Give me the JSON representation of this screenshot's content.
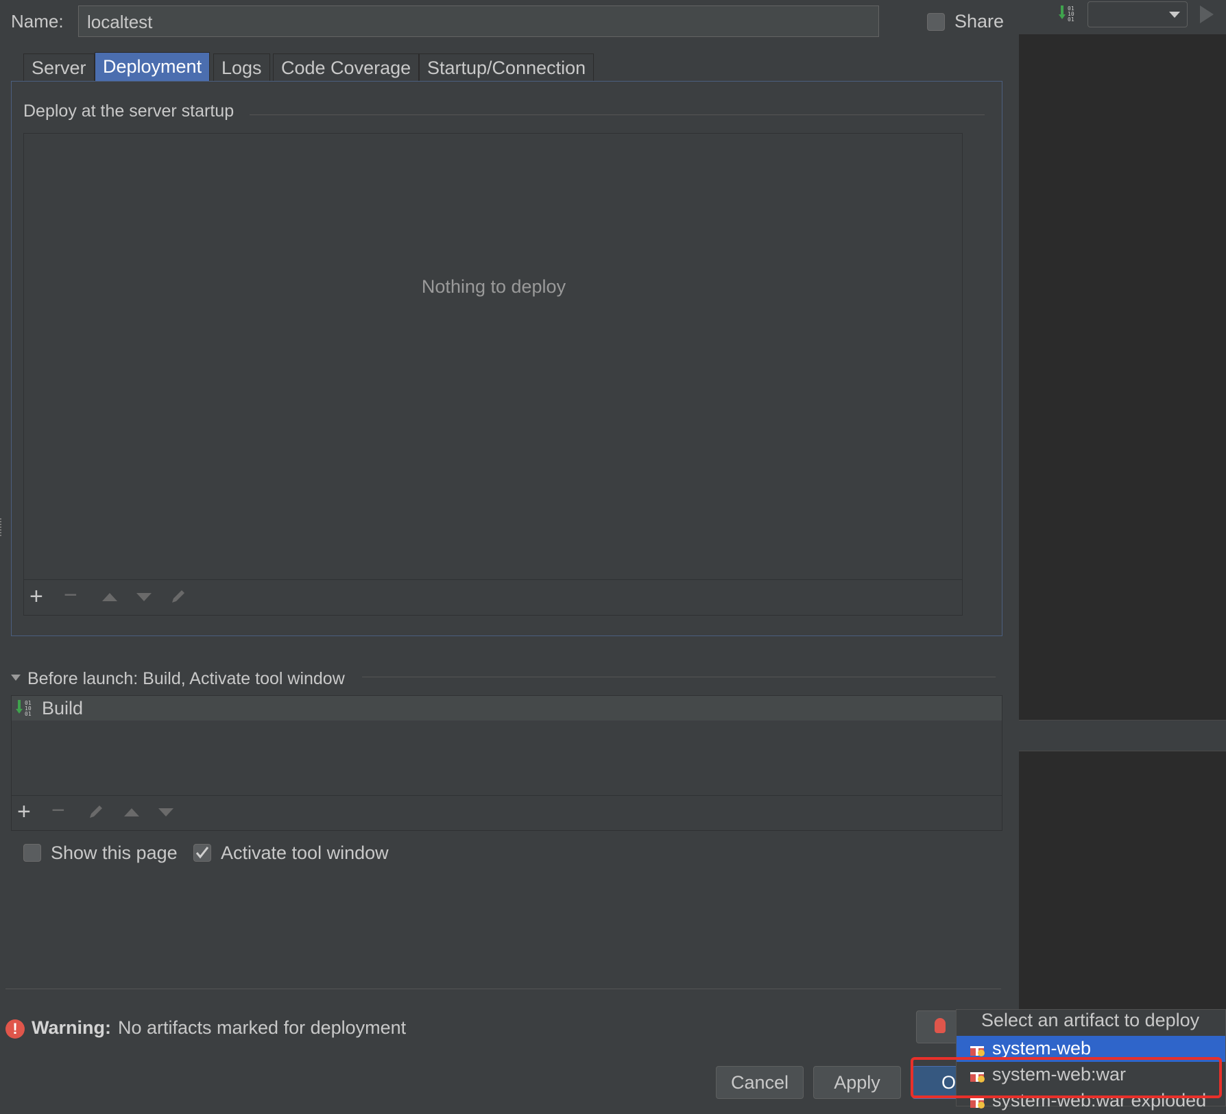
{
  "header": {
    "name_label": "Name:",
    "name_value": "localtest",
    "share_label": "Share"
  },
  "tabs": [
    {
      "label": "Server",
      "selected": false
    },
    {
      "label": "Deployment",
      "selected": true
    },
    {
      "label": "Logs",
      "selected": false
    },
    {
      "label": "Code Coverage",
      "selected": false
    },
    {
      "label": "Startup/Connection",
      "selected": false
    }
  ],
  "deployment": {
    "section_title": "Deploy at the server startup",
    "empty_text": "Nothing to deploy"
  },
  "before_launch": {
    "title": "Before launch: Build, Activate tool window",
    "items": [
      {
        "label": "Build",
        "icon": "build-icon"
      }
    ]
  },
  "options": {
    "show_page_label": "Show this page",
    "show_page_checked": false,
    "activate_label": "Activate tool window",
    "activate_checked": true
  },
  "warning": {
    "bold": "Warning:",
    "text": "No artifacts marked for deployment"
  },
  "buttons": {
    "cancel": "Cancel",
    "apply": "Apply",
    "ok_partial": "O"
  },
  "artifact_popup": {
    "title": "Select an artifact to deploy",
    "items": [
      {
        "label": "system-web",
        "selected": true
      },
      {
        "label": "system-web:war",
        "selected": false,
        "highlighted": true
      },
      {
        "label": "system-web:war exploded",
        "selected": false
      }
    ]
  },
  "colors": {
    "background": "#3c3f41",
    "selection": "#4b6eaf",
    "popup_selection": "#2f65ca",
    "warning": "#e0564b",
    "highlight_box": "#e8302a"
  }
}
